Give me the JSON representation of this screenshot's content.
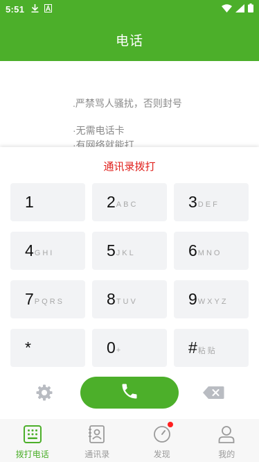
{
  "status_bar": {
    "time": "5:51",
    "icons": [
      "download-icon",
      "font-icon",
      "wifi-icon",
      "signal-icon",
      "battery-icon"
    ]
  },
  "app_bar": {
    "title": "电话"
  },
  "notices": [
    ".严禁骂人骚扰，否则封号",
    "·无需电话卡",
    "·有网络就能打"
  ],
  "keypad": {
    "contacts_dial_label": "通讯录拨打",
    "keys": [
      {
        "digit": "1",
        "letters": ""
      },
      {
        "digit": "2",
        "letters": "ABC"
      },
      {
        "digit": "3",
        "letters": "DEF"
      },
      {
        "digit": "4",
        "letters": "GHI"
      },
      {
        "digit": "5",
        "letters": "JKL"
      },
      {
        "digit": "6",
        "letters": "MNO"
      },
      {
        "digit": "7",
        "letters": "PQRS"
      },
      {
        "digit": "8",
        "letters": "TUV"
      },
      {
        "digit": "9",
        "letters": "WXYZ"
      },
      {
        "digit": "*",
        "letters": ""
      },
      {
        "digit": "0",
        "letters": "+"
      },
      {
        "digit": "#",
        "letters": "粘贴"
      }
    ]
  },
  "controls": {
    "settings_icon": "gear-icon",
    "call_icon": "phone-icon",
    "backspace_icon": "backspace-icon"
  },
  "tabs": [
    {
      "label": "拨打电话",
      "icon": "dialpad-icon",
      "active": true
    },
    {
      "label": "通讯录",
      "icon": "contacts-icon",
      "active": false
    },
    {
      "label": "发现",
      "icon": "compass-icon",
      "active": false,
      "badge": "red-dot"
    },
    {
      "label": "我的",
      "icon": "user-icon",
      "active": false
    }
  ],
  "colors": {
    "primary": "#4caf2a",
    "accent_red": "#e0201c",
    "key_bg": "#f2f3f5",
    "text_gray": "#8a8a8a"
  }
}
